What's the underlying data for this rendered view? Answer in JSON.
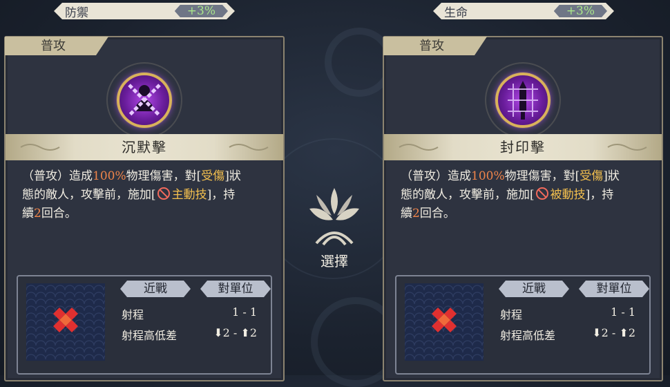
{
  "left": {
    "stat": {
      "name": "防禦",
      "value": "+3%"
    },
    "tab": "普攻",
    "skill_name": "沉默擊",
    "desc": {
      "p1": "（普攻）造成",
      "pct": "100%",
      "p2": "物理傷害，對[",
      "status": "受傷",
      "p3": "]狀",
      "p4": "態的敵人，攻擊前，施加[",
      "effect": "主動技",
      "p5": "]，持",
      "p6": "續",
      "turns": "2",
      "p7": "回合。"
    },
    "chips": [
      "近戰",
      "對單位"
    ],
    "rows": [
      {
        "label": "射程",
        "value": "1 - 1"
      },
      {
        "label": "射程高低差",
        "value": "⬇2 - ⬆2"
      }
    ],
    "emblem_icon": "chained-silhouette-icon"
  },
  "right": {
    "stat": {
      "name": "生命",
      "value": "+3%"
    },
    "tab": "普攻",
    "skill_name": "封印擊",
    "desc": {
      "p1": "（普攻）造成",
      "pct": "100%",
      "p2": "物理傷害，對[",
      "status": "受傷",
      "p3": "]狀",
      "p4": "態的敵人，攻擊前，施加[",
      "effect": "被動技",
      "p5": "]，持",
      "p6": "續",
      "turns": "2",
      "p7": "回合。"
    },
    "chips": [
      "近戰",
      "對單位"
    ],
    "rows": [
      {
        "label": "射程",
        "value": "1 - 1"
      },
      {
        "label": "射程高低差",
        "value": "⬇2 - ⬆2"
      }
    ],
    "emblem_icon": "sealed-sword-icon"
  },
  "center": {
    "label": "選擇",
    "icon": "tree-emblem-icon"
  },
  "colors": {
    "gain": "#a9e68a",
    "highlight": "#f0854a",
    "status": "#f4c04e",
    "effect": "#f26a5c",
    "card_border": "#8c8470"
  }
}
